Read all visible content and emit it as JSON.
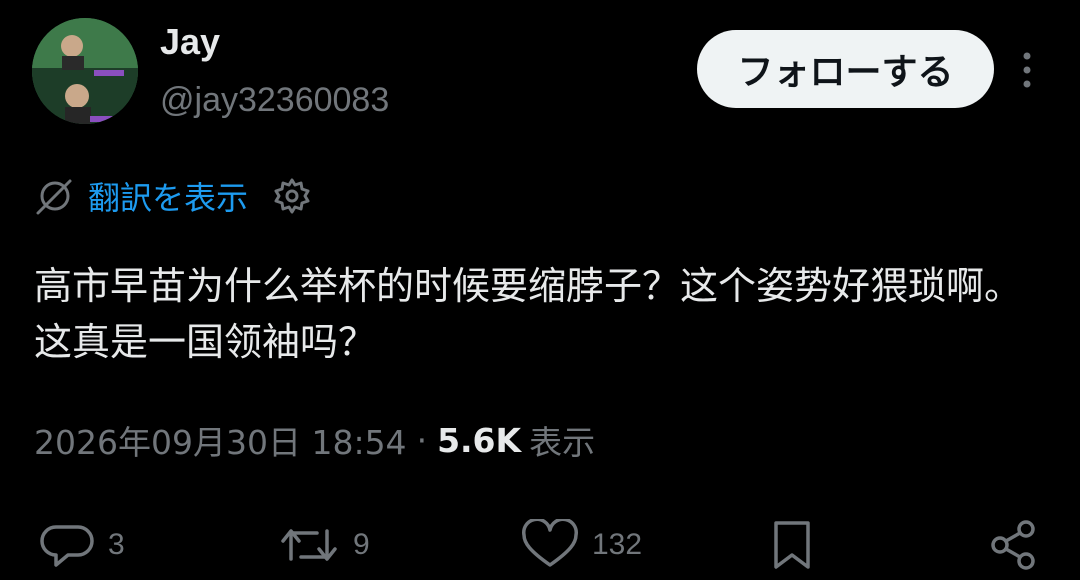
{
  "user": {
    "display_name": "Jay",
    "handle": "@jay32360083",
    "avatar_icon": "profile-photo"
  },
  "header": {
    "follow_label": "フォローする",
    "more_icon": "more-vertical-icon"
  },
  "translation": {
    "show_label": "翻訳を表示",
    "translate_icon": "globe-slash-icon",
    "settings_icon": "gear-icon"
  },
  "tweet": {
    "text": "高市早苗为什么举杯的时候要缩脖子？这个姿势好猥琐啊。这真是一国领袖吗？",
    "timestamp": "2026年09月30日 18:54",
    "separator": "·",
    "views_count": "5.6K",
    "views_label": "表示"
  },
  "actions": {
    "replies": {
      "icon": "reply-icon",
      "count": "3"
    },
    "retweets": {
      "icon": "retweet-icon",
      "count": "9"
    },
    "likes": {
      "icon": "heart-icon",
      "count": "132"
    },
    "bookmark": {
      "icon": "bookmark-icon"
    },
    "share": {
      "icon": "share-icon"
    }
  },
  "colors": {
    "background": "#000000",
    "text_primary": "#e7e9ea",
    "text_secondary": "#71767b",
    "accent_link": "#1d9bf0",
    "button_bg": "#eff3f4"
  }
}
